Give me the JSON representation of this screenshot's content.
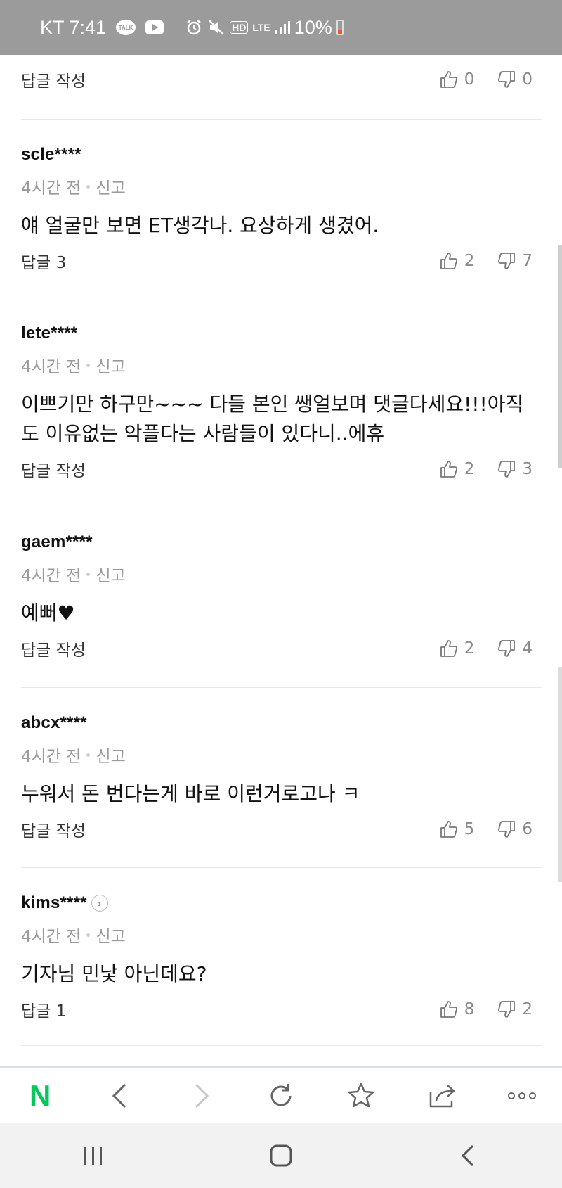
{
  "status_bar": {
    "carrier_time": "KT 7:41",
    "talk_icon": "kakaotalk-icon",
    "talk_text": "TALK",
    "youtube_icon": "youtube-icon",
    "network": "LTE",
    "hd": "HD",
    "battery": "10%",
    "battery_color": "#f05a28"
  },
  "partial_row": {
    "reply_label": "답글 작성",
    "likes": "0",
    "dislikes": "0"
  },
  "comments": [
    {
      "username": "scle****",
      "time": "4시간 전",
      "report": "신고",
      "text": "얘 얼굴만 보면 ET생각나. 요상하게 생겼어.",
      "reply_label": "답글 3",
      "likes": "2",
      "dislikes": "7"
    },
    {
      "username": "lete****",
      "time": "4시간 전",
      "report": "신고",
      "text_line1": "이쁘기만 하구만~~~ 다들 본인 쌩얼보며 댓글다세요!!!아직",
      "text_line2": "도 이유없는 악플다는 사람들이 있다니..에휴",
      "reply_label": "답글 작성",
      "likes": "2",
      "dislikes": "3"
    },
    {
      "username": "gaem****",
      "time": "4시간 전",
      "report": "신고",
      "text": "예뻐♥",
      "reply_label": "답글 작성",
      "likes": "2",
      "dislikes": "4"
    },
    {
      "username": "abcx****",
      "time": "4시간 전",
      "report": "신고",
      "text": "누워서 돈 번다는게 바로 이런거로고나 ㅋ",
      "reply_label": "답글 작성",
      "likes": "5",
      "dislikes": "6"
    },
    {
      "username": "kims****",
      "time": "4시간 전",
      "report": "신고",
      "text": "기자님 민낯 아닌데요?",
      "reply_label": "답글 1",
      "likes": "8",
      "dislikes": "2"
    }
  ],
  "toolbar": {
    "brand_letter": "N",
    "brand_color": "#03c75a",
    "items": [
      "naver-home",
      "back-icon",
      "forward-icon",
      "refresh-icon",
      "bookmark-star-icon",
      "share-icon",
      "more-icon"
    ]
  },
  "system_nav": {
    "items": [
      "recent-apps-icon",
      "home-icon",
      "back-icon"
    ]
  }
}
